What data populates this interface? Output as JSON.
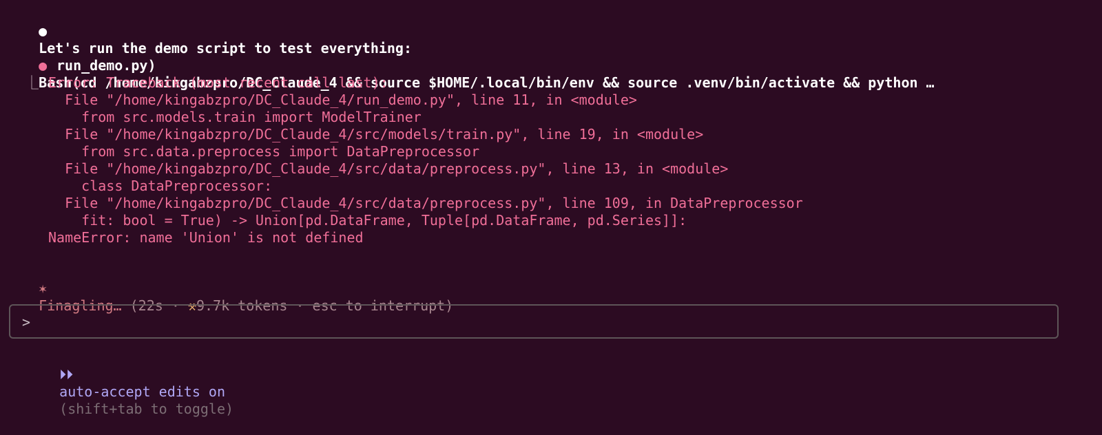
{
  "messages": {
    "assistant_text": "Let's run the demo script to test everything:",
    "assistant_bullet": "●",
    "tool_bullet": "●",
    "tool_call_line1": "Bash(cd /home/kingabzpro/DC_Claude_4 && source $HOME/.local/bin/env && source .venv/bin/activate && python …",
    "tool_call_line2": "run_demo.py)",
    "result_elbow": "⎿",
    "error_lines": [
      "Error: Traceback (most recent call last):",
      "  File \"/home/kingabzpro/DC_Claude_4/run_demo.py\", line 11, in <module>",
      "    from src.models.train import ModelTrainer",
      "  File \"/home/kingabzpro/DC_Claude_4/src/models/train.py\", line 19, in <module>",
      "    from src.data.preprocess import DataPreprocessor",
      "  File \"/home/kingabzpro/DC_Claude_4/src/data/preprocess.py\", line 13, in <module>",
      "    class DataPreprocessor:",
      "  File \"/home/kingabzpro/DC_Claude_4/src/data/preprocess.py\", line 109, in DataPreprocessor",
      "    fit: bool = True) -> Union[pd.DataFrame, Tuple[pd.DataFrame, pd.Series]]:",
      "NameError: name 'Union' is not defined"
    ]
  },
  "status": {
    "spinner_icon": "✶",
    "label": "Finagling…",
    "details_prefix": " (22s · ",
    "tokens_icon": "⚒",
    "details_suffix": "9.7k tokens · esc to interrupt)"
  },
  "input": {
    "prompt_symbol": ">",
    "value": ""
  },
  "mode": {
    "arrows": "⏵⏵",
    "label": "auto-accept edits on",
    "hint": "(shift+tab to toggle)"
  },
  "colors": {
    "background": "#2c0b22",
    "error": "#f06f98",
    "status": "#d27a82",
    "mode": "#b0a7f5"
  }
}
